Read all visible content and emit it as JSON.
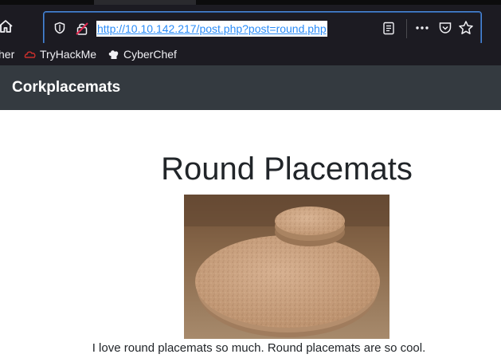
{
  "browser": {
    "url": "http://10.10.142.217/post.php?post=round.php",
    "bookmarks": [
      {
        "label": "her",
        "icon": "folder-icon"
      },
      {
        "label": "TryHackMe",
        "icon": "tryhackme-icon"
      },
      {
        "label": "CyberChef",
        "icon": "cyberchef-icon"
      }
    ]
  },
  "site": {
    "brand": "Corkplacemats"
  },
  "post": {
    "title": "Round Placemats",
    "image_subject": "stack of round cork placemats with a small cork coaster on top",
    "text": "I love round placemats so much. Round placemats are so cool."
  },
  "colors": {
    "browser_bg": "#1c1b22",
    "url_focus": "#4a88d8",
    "navbar_bg": "#343a40",
    "cork": "#c9a07c"
  }
}
